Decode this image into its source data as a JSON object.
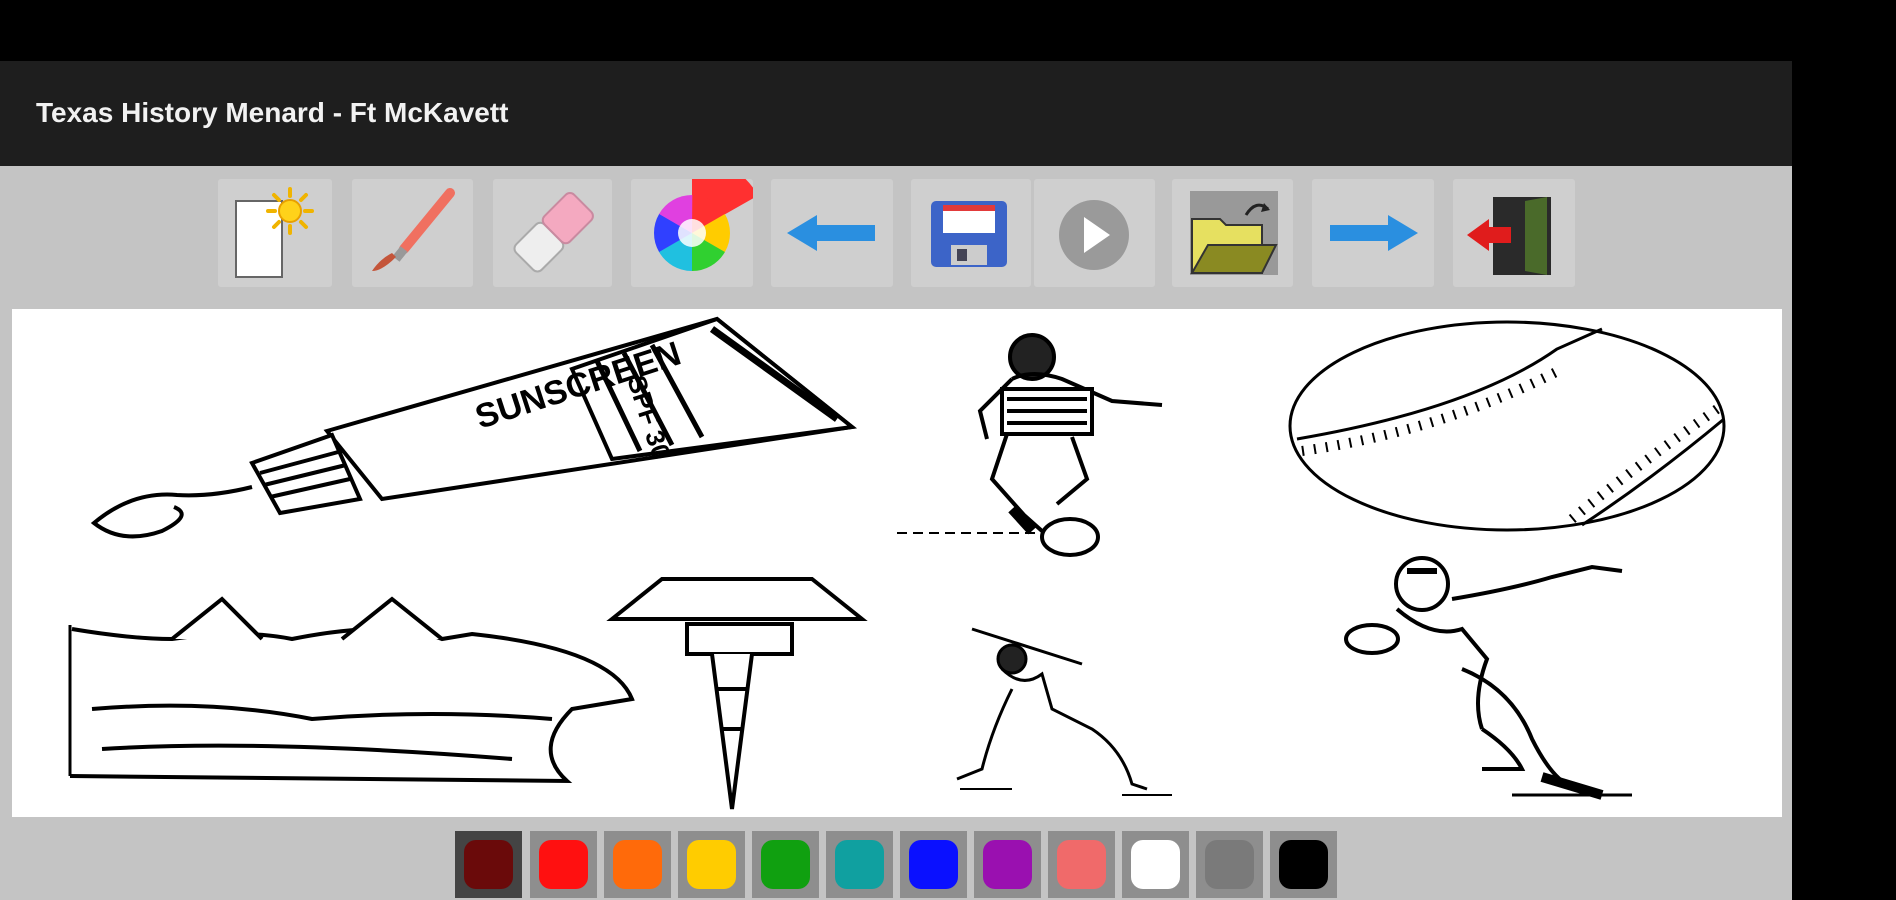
{
  "window": {
    "title": "Texas History Menard - Ft McKavett"
  },
  "toolbar": {
    "buttons": [
      {
        "name": "new-page",
        "icon": "new-page-icon"
      },
      {
        "name": "brush",
        "icon": "paintbrush-icon"
      },
      {
        "name": "eraser",
        "icon": "eraser-icon"
      },
      {
        "name": "color-wheel",
        "icon": "color-wheel-icon"
      },
      {
        "name": "previous",
        "icon": "arrow-left-icon"
      },
      {
        "name": "save",
        "icon": "floppy-disk-icon"
      },
      {
        "name": "play",
        "icon": "play-icon"
      },
      {
        "name": "open",
        "icon": "open-folder-icon"
      },
      {
        "name": "next",
        "icon": "arrow-right-icon"
      },
      {
        "name": "exit",
        "icon": "exit-door-icon"
      }
    ]
  },
  "canvas": {
    "drawings": [
      {
        "name": "sunscreen-tube",
        "label": "SUNSCREEN",
        "spf": "SPF 30"
      },
      {
        "name": "soccer-player"
      },
      {
        "name": "baseball"
      },
      {
        "name": "lawn-lamp"
      },
      {
        "name": "baseball-batter"
      },
      {
        "name": "football-player"
      }
    ]
  },
  "palette": {
    "selected": 0,
    "colors": [
      "#6a0a0a",
      "#ff1010",
      "#ff6a0a",
      "#ffcc00",
      "#10a010",
      "#10a0a0",
      "#0a10ff",
      "#9a10b0",
      "#f06a6a",
      "#ffffff",
      "#7a7a7a",
      "#000000"
    ]
  }
}
